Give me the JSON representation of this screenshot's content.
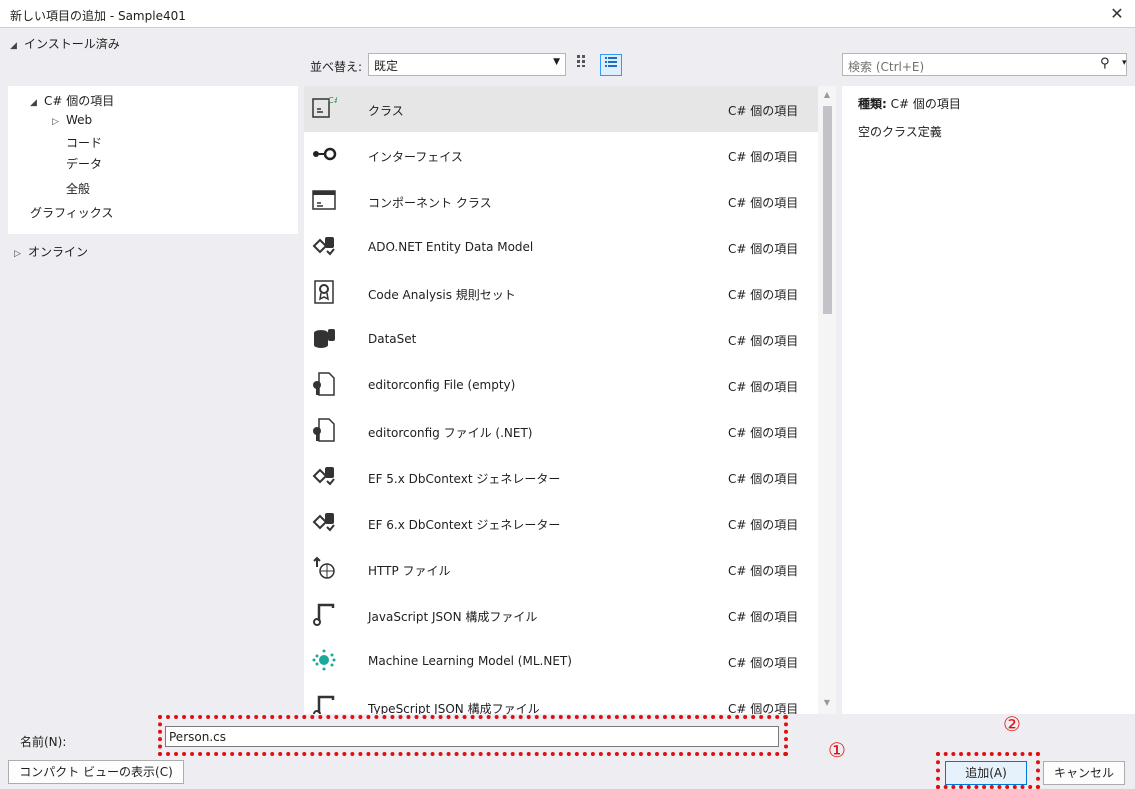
{
  "window": {
    "title": "新しい項目の追加 - Sample401",
    "close_glyph": "✕"
  },
  "tree": {
    "header": "インストール済み",
    "items": [
      {
        "label": "C# 個の項目",
        "expander": "◢"
      },
      {
        "label": "Web",
        "expander": "▷"
      },
      {
        "label": "コード"
      },
      {
        "label": "データ"
      },
      {
        "label": "全般"
      },
      {
        "label": "グラフィックス"
      }
    ],
    "online": "オンライン"
  },
  "toolbar": {
    "sort_label": "並べ替え:",
    "sort_value": "既定"
  },
  "search": {
    "placeholder": "検索 (Ctrl+E)"
  },
  "list": {
    "items": [
      {
        "name": "クラス",
        "type": "C# 個の項目",
        "icon": "class-icon"
      },
      {
        "name": "インターフェイス",
        "type": "C# 個の項目",
        "icon": "interface-icon"
      },
      {
        "name": "コンポーネント クラス",
        "type": "C# 個の項目",
        "icon": "component-class-icon"
      },
      {
        "name": "ADO.NET Entity Data Model",
        "type": "C# 個の項目",
        "icon": "entity-model-icon"
      },
      {
        "name": "Code Analysis 規則セット",
        "type": "C# 個の項目",
        "icon": "ruleset-icon"
      },
      {
        "name": "DataSet",
        "type": "C# 個の項目",
        "icon": "dataset-icon"
      },
      {
        "name": "editorconfig File (empty)",
        "type": "C# 個の項目",
        "icon": "config-file-icon"
      },
      {
        "name": "editorconfig ファイル (.NET)",
        "type": "C# 個の項目",
        "icon": "config-file-icon"
      },
      {
        "name": "EF 5.x DbContext ジェネレーター",
        "type": "C# 個の項目",
        "icon": "entity-model-icon"
      },
      {
        "name": "EF 6.x DbContext ジェネレーター",
        "type": "C# 個の項目",
        "icon": "entity-model-icon"
      },
      {
        "name": "HTTP ファイル",
        "type": "C# 個の項目",
        "icon": "http-file-icon"
      },
      {
        "name": "JavaScript JSON 構成ファイル",
        "type": "C# 個の項目",
        "icon": "json-config-icon"
      },
      {
        "name": "Machine Learning Model (ML.NET)",
        "type": "C# 個の項目",
        "icon": "ml-model-icon"
      },
      {
        "name": "TypeScript JSON 構成ファイル",
        "type": "C# 個の項目",
        "icon": "json-config-icon"
      }
    ]
  },
  "detail": {
    "kind_label": "種類:",
    "kind_value": "C# 個の項目",
    "description": "空のクラス定義"
  },
  "bottom": {
    "name_label": "名前(N):",
    "name_value": "Person.cs",
    "compact_button": "コンパクト ビューの表示(C)",
    "add_button": "追加(A)",
    "cancel_button": "キャンセル"
  },
  "annotations": {
    "marker1": "①",
    "marker2": "②"
  },
  "colors": {
    "highlight_red": "#e01010",
    "selected_row": "#e6e6e6",
    "accent": "#0078d7"
  }
}
